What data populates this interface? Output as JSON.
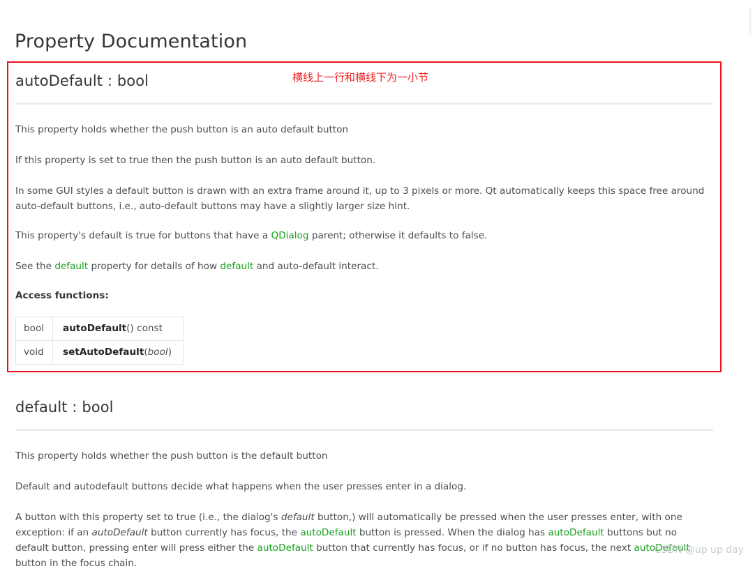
{
  "page": {
    "title": "Property Documentation",
    "watermark": "CSDN @up up day"
  },
  "annotation": {
    "note": "横线上一行和横线下为一小节",
    "color": "#e8121d"
  },
  "colors": {
    "link": "#17a01c",
    "heading": "#33363a",
    "body": "#4a4e52",
    "rule": "#eaebec",
    "table_border": "#e4e5e6"
  },
  "sections": [
    {
      "heading": "autoDefault : bool",
      "paragraphs": [
        "This property holds whether the push button is an auto default button",
        "If this property is set to true then the push button is an auto default button.",
        "In some GUI styles a default button is drawn with an extra frame around it, up to 3 pixels or more. Qt automatically keeps this space free around auto-default buttons, i.e., auto-default buttons may have a slightly larger size hint.",
        "This property's default is true for buttons that have a QDialog parent; otherwise it defaults to false.",
        "See the default property for details of how default and auto-default interact."
      ],
      "p4_pre": "This property's default is true for buttons that have a ",
      "p4_link": "QDialog",
      "p4_post": " parent; otherwise it defaults to false.",
      "p5_pre": "See the ",
      "p5_link1": "default",
      "p5_mid": " property for details of how ",
      "p5_link2": "default",
      "p5_post": " and auto-default interact.",
      "access_label": "Access functions:",
      "access_functions": {
        "rows": [
          {
            "return_type": "bool",
            "name": "autoDefault",
            "args": "",
            "suffix": "() const"
          },
          {
            "return_type": "void",
            "name": "setAutoDefault",
            "args": "bool",
            "suffix": ""
          }
        ]
      }
    },
    {
      "heading": "default : bool",
      "paragraphs": [
        "This property holds whether the push button is the default button",
        "Default and autodefault buttons decide what happens when the user presses enter in a dialog.",
        "A button with this property set to true (i.e., the dialog's default button,) will automatically be pressed when the user presses enter, with one exception: if an autoDefault button currently has focus, the autoDefault button is pressed. When the dialog has autoDefault buttons but no default button, pressing enter will press either the autoDefault button that currently has focus, or if no button has focus, the next autoDefault button in the focus chain."
      ],
      "p3_parts": {
        "a": "A button with this property set to true (i.e., the dialog's ",
        "em1": "default",
        "b": " button,) will automatically be pressed when the user presses enter, with one exception: if an ",
        "em2": "autoDefault",
        "c": " button currently has focus, the ",
        "link1": "autoDefault",
        "d": " button is pressed. When the dialog has ",
        "link2": "autoDefault",
        "e": " buttons but no default button, pressing enter will press either the ",
        "link3": "autoDefault",
        "f": " button that currently has focus, or if no button has focus, the next ",
        "link4": "autoDefault",
        "g": " button in the focus chain."
      }
    }
  ]
}
